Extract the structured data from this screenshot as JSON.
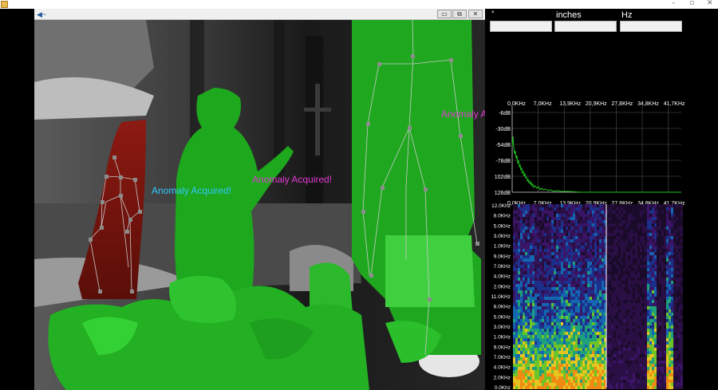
{
  "annotations": [
    {
      "text": "Anomaly Acquired!",
      "color": "#34c6ff"
    },
    {
      "text": "Anomaly Acquired!",
      "color": "#e23ad3"
    },
    {
      "text": "Anomaly A",
      "color": "#e23ad3"
    }
  ],
  "readouts": {
    "degree_mark": "°",
    "units": [
      "inches",
      "Hz"
    ]
  },
  "spectrum": {
    "freq_labels": [
      "0,0KHz",
      "7,0KHz",
      "13,9KHz",
      "20,9KHz",
      "27,8KHz",
      "34,8KHz",
      "41,7KHz"
    ],
    "db_labels": [
      "-6dB",
      "-30dB",
      "-54dB",
      "-78dB",
      "102dB",
      "126dB"
    ],
    "trace_color": "#1ec41e"
  },
  "spectrogram": {
    "freq_labels": [
      "12.0Khz",
      "8.0KHz",
      "5.0KHz",
      "3.0KHz",
      "1.0KHz",
      "9.0KHz",
      "7.0KHz",
      "4.0KHz",
      "2.0KHz",
      "11.0KHz",
      "8.0KHz",
      "5.0KHz",
      "3.0KHz",
      "1.0KHz",
      "9.0KHz",
      "7.0KHz",
      "4.0KHz",
      "2.0KHz",
      "0.0Khz"
    ]
  }
}
